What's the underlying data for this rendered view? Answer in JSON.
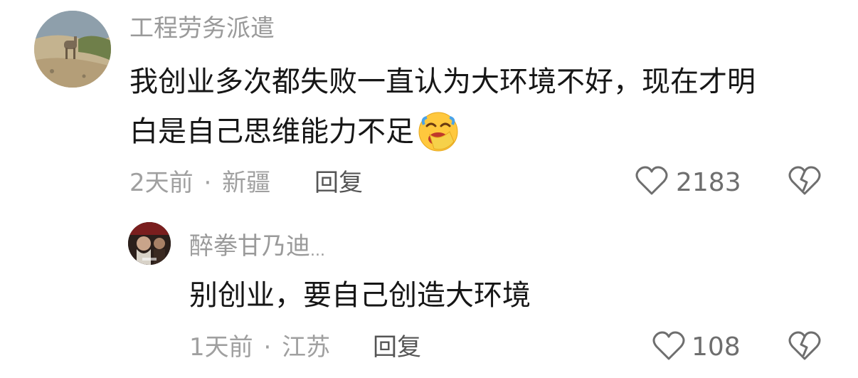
{
  "comments": [
    {
      "username": "工程劳务派遣",
      "text_line1": "我创业多次都失败一直认为大环境不好，现在才明",
      "text_line2": "白是自己思维能力不足",
      "emoji_icon": "face-with-hand-over-mouth-laughing-emoji",
      "time": "2天前",
      "separator": "·",
      "location": "新疆",
      "reply_label": "回复",
      "like_count": "2183",
      "like_icon": "heart-outline-icon",
      "dislike_icon": "broken-heart-outline-icon"
    },
    {
      "username": "醉拳甘乃迪",
      "username_suffix": "...",
      "text": "别创业，要自己创造大环境",
      "time": "1天前",
      "separator": "·",
      "location": "江苏",
      "reply_label": "回复",
      "like_count": "108",
      "like_icon": "heart-outline-icon",
      "dislike_icon": "broken-heart-outline-icon"
    }
  ],
  "colors": {
    "text_primary": "#161616",
    "text_secondary": "#9a9a9a",
    "reply_text": "#555555",
    "icon_stroke": "#6e6e6e",
    "emoji_yellow": "#ffc83d",
    "emoji_blue": "#4aa3e8"
  }
}
